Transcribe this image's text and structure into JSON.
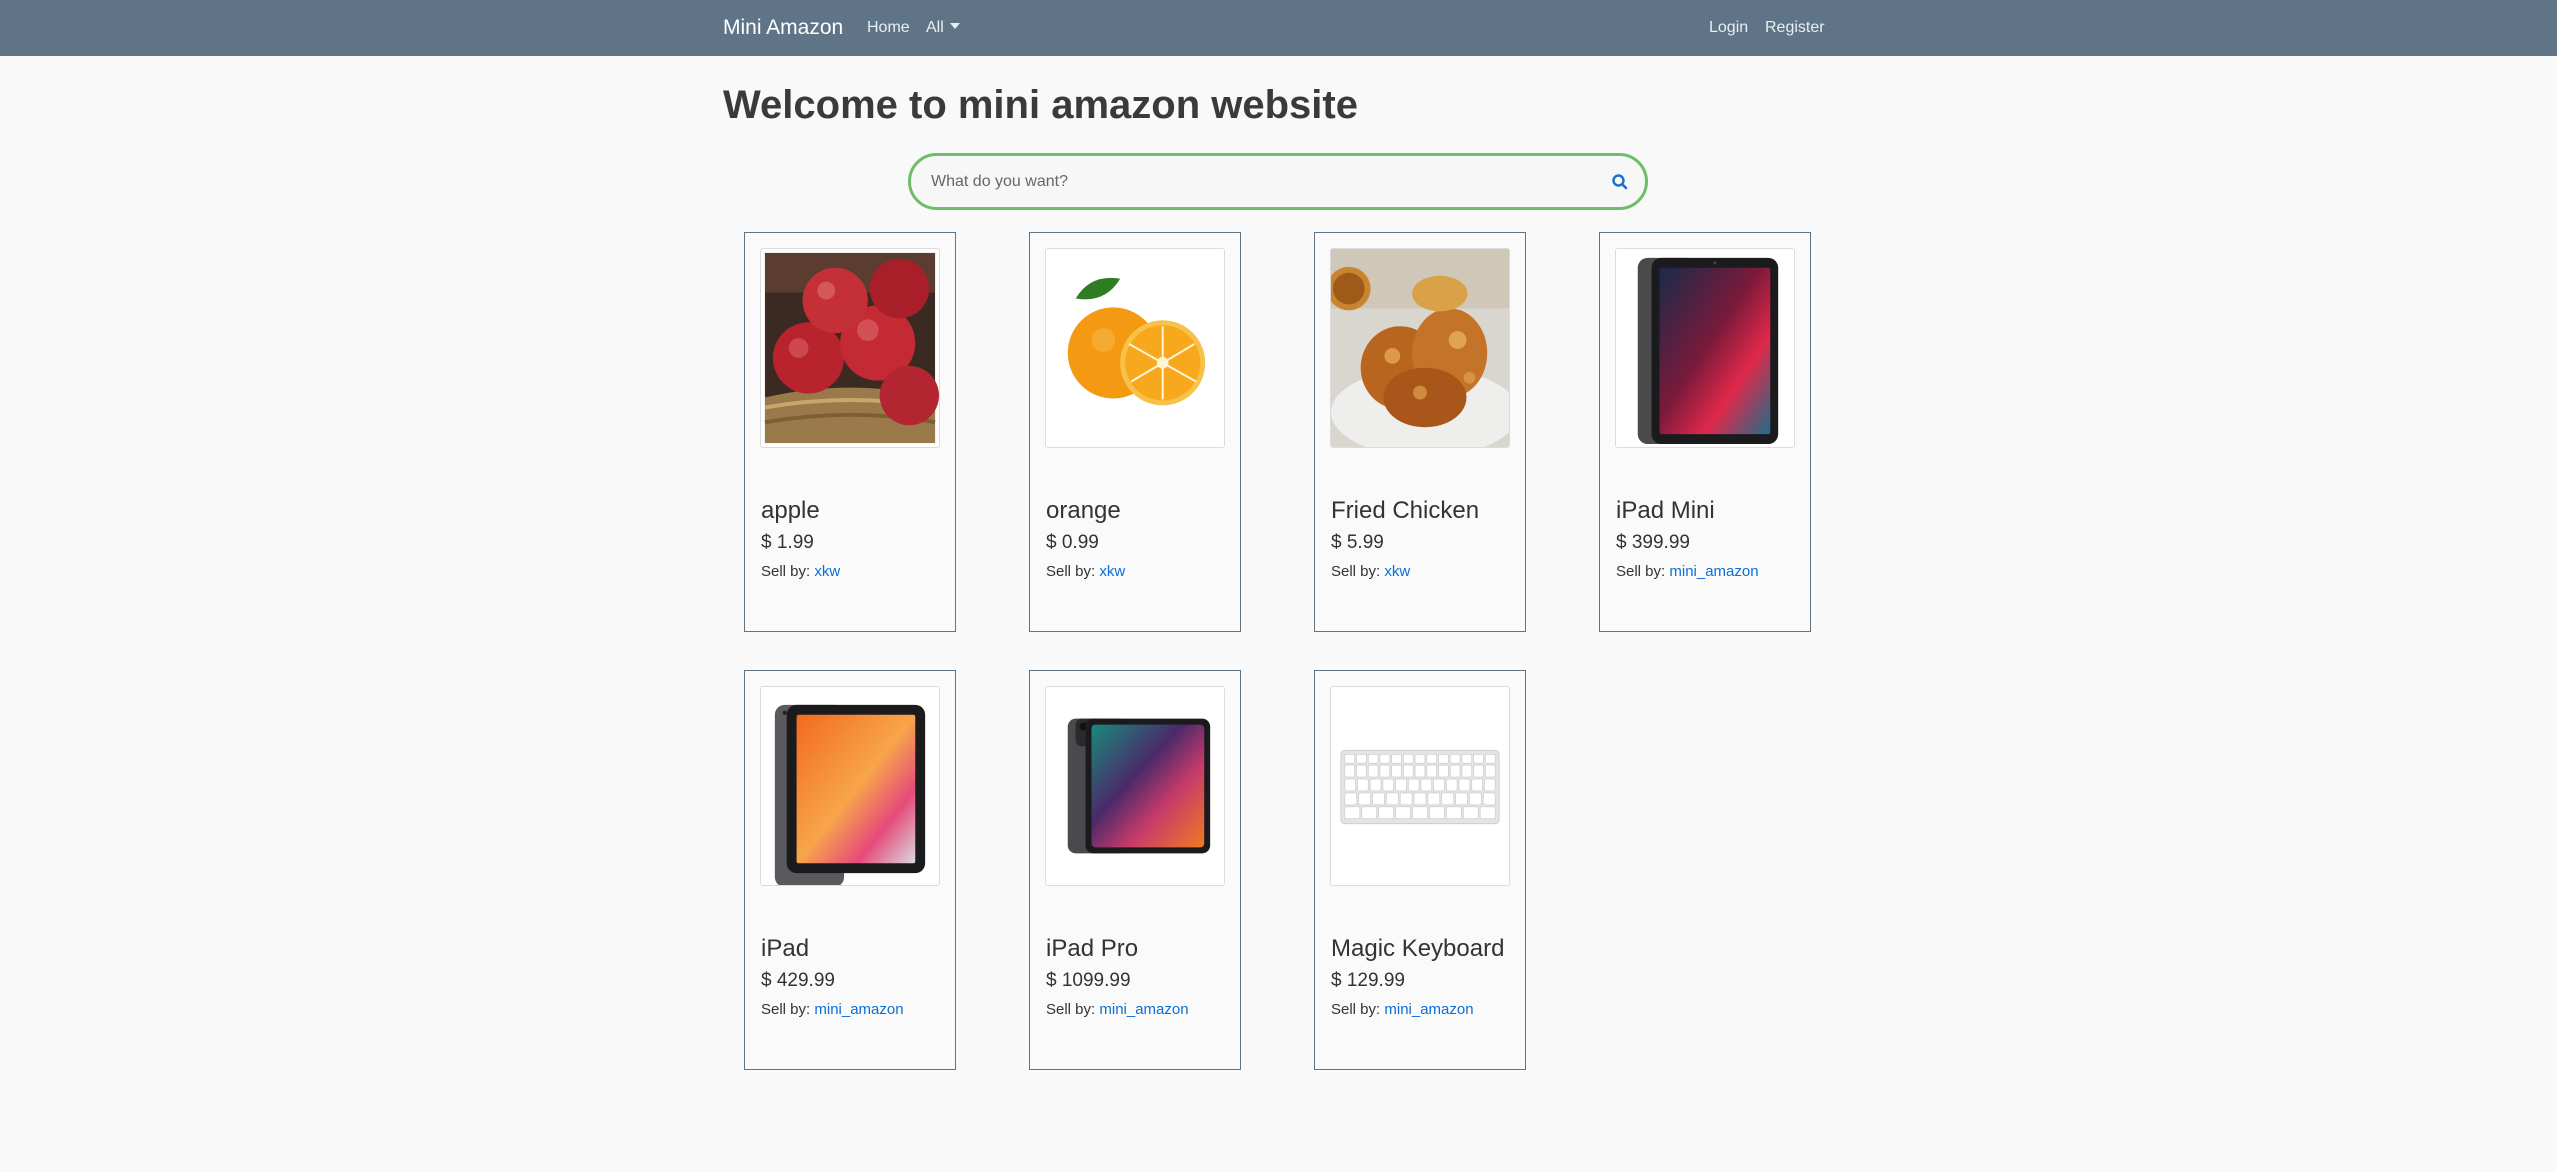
{
  "nav": {
    "brand": "Mini Amazon",
    "home": "Home",
    "all": "All",
    "login": "Login",
    "register": "Register"
  },
  "page": {
    "title": "Welcome to mini amazon website"
  },
  "search": {
    "placeholder": "What do you want?"
  },
  "products": [
    {
      "name": "apple",
      "price": "$ 1.99",
      "sell_by_label": "Sell by:",
      "seller": "xkw",
      "image": "apple-photo"
    },
    {
      "name": "orange",
      "price": "$ 0.99",
      "sell_by_label": "Sell by:",
      "seller": "xkw",
      "image": "orange-photo"
    },
    {
      "name": "Fried Chicken",
      "price": "$ 5.99",
      "sell_by_label": "Sell by:",
      "seller": "xkw",
      "image": "fried-chicken-photo"
    },
    {
      "name": "iPad Mini",
      "price": "$ 399.99",
      "sell_by_label": "Sell by:",
      "seller": "mini_amazon",
      "image": "ipad-mini-photo"
    },
    {
      "name": "iPad",
      "price": "$ 429.99",
      "sell_by_label": "Sell by:",
      "seller": "mini_amazon",
      "image": "ipad-photo"
    },
    {
      "name": "iPad Pro",
      "price": "$ 1099.99",
      "sell_by_label": "Sell by:",
      "seller": "mini_amazon",
      "image": "ipad-pro-photo"
    },
    {
      "name": "Magic Keyboard",
      "price": "$ 129.99",
      "sell_by_label": "Sell by:",
      "seller": "mini_amazon",
      "image": "keyboard-photo"
    }
  ],
  "colors": {
    "navbar": "#5f7587",
    "link": "#0a6fd8",
    "search_border": "#6dbd6a"
  }
}
